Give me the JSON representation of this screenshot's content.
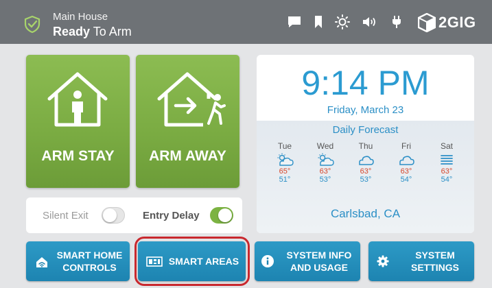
{
  "status": {
    "location": "Main House",
    "state_bold": "Ready",
    "state_rest": " To Arm",
    "icon": "shield-check-icon"
  },
  "topbar_icons": [
    "message-icon",
    "bookmark-icon",
    "brightness-icon",
    "volume-icon",
    "power-plug-icon"
  ],
  "brand": {
    "name": "2GIG",
    "icon": "2gig-cube-logo"
  },
  "arm": {
    "stay_label": "ARM STAY",
    "away_label": "ARM AWAY"
  },
  "options": {
    "silent_exit": {
      "label": "Silent Exit",
      "enabled": false
    },
    "entry_delay": {
      "label": "Entry Delay",
      "enabled": true
    }
  },
  "clock": {
    "time": "9:14 PM",
    "date": "Friday, March 23"
  },
  "forecast": {
    "title": "Daily Forecast",
    "days": [
      {
        "name": "Tue",
        "icon": "partly-sunny-icon",
        "hi": "65°",
        "lo": "51°"
      },
      {
        "name": "Wed",
        "icon": "partly-sunny-icon",
        "hi": "63°",
        "lo": "53°"
      },
      {
        "name": "Thu",
        "icon": "cloudy-icon",
        "hi": "63°",
        "lo": "53°"
      },
      {
        "name": "Fri",
        "icon": "cloudy-icon",
        "hi": "63°",
        "lo": "54°"
      },
      {
        "name": "Sat",
        "icon": "fog-icon",
        "hi": "63°",
        "lo": "54°"
      }
    ],
    "location": "Carlsbad, CA"
  },
  "nav": {
    "smart_home": {
      "line1": "SMART HOME",
      "line2": "CONTROLS",
      "icon": "home-wifi-icon"
    },
    "smart_areas": {
      "label": "SMART AREAS",
      "icon": "areas-grid-icon"
    },
    "system_info": {
      "line1": "SYSTEM INFO",
      "line2": "AND USAGE",
      "icon": "info-icon"
    },
    "system_settings": {
      "line1": "SYSTEM",
      "line2": "SETTINGS",
      "icon": "gear-icon"
    }
  },
  "colors": {
    "topbar": "#6e7276",
    "arm_green": "#7aab42",
    "accent_blue": "#2b9bd1",
    "nav_blue": "#1d84b1",
    "temp_high": "#d6472b",
    "toggle_on": "#7cb342",
    "highlight": "#c9282e"
  }
}
